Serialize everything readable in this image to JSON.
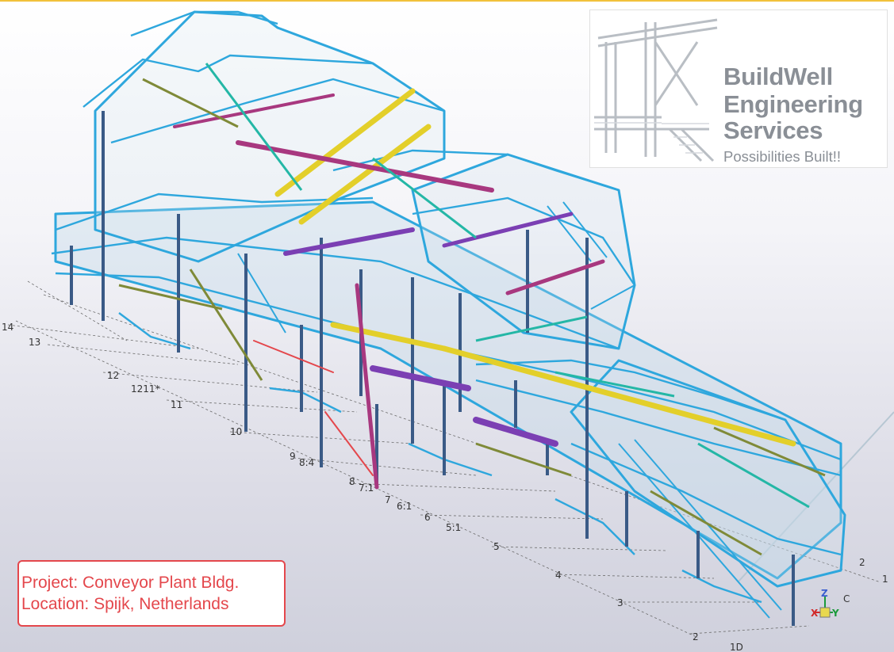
{
  "logo": {
    "line1": "BuildWell",
    "line2": "Engineering",
    "line3": "Services",
    "tagline": "Possibilities Built!!"
  },
  "project_info": {
    "project": "Project: Conveyor Plant Bldg.",
    "location": "Location: Spijk, Netherlands"
  },
  "grid_labels": [
    "14",
    "13",
    "12",
    "1211*",
    "11",
    "10",
    "9",
    "8:4",
    "8",
    "7:1",
    "7",
    "6:1",
    "6",
    "5:1",
    "5",
    "4",
    "3",
    "2",
    "1D",
    "C",
    "2",
    "1"
  ],
  "axis_triad": {
    "z": "Z",
    "x": "X",
    "y": "Y"
  },
  "colors": {
    "accent_border": "#e4474c",
    "steel_blue": "#2ea7dd",
    "column_navy": "#3a5a86",
    "member_yellow": "#e3cf2a",
    "member_magenta": "#a8387f",
    "member_purple": "#7b3fb3",
    "member_olive": "#7f8a38",
    "member_teal": "#24b7a6"
  },
  "icons": [
    "building-frame-logo-icon",
    "axis-triad-icon"
  ]
}
